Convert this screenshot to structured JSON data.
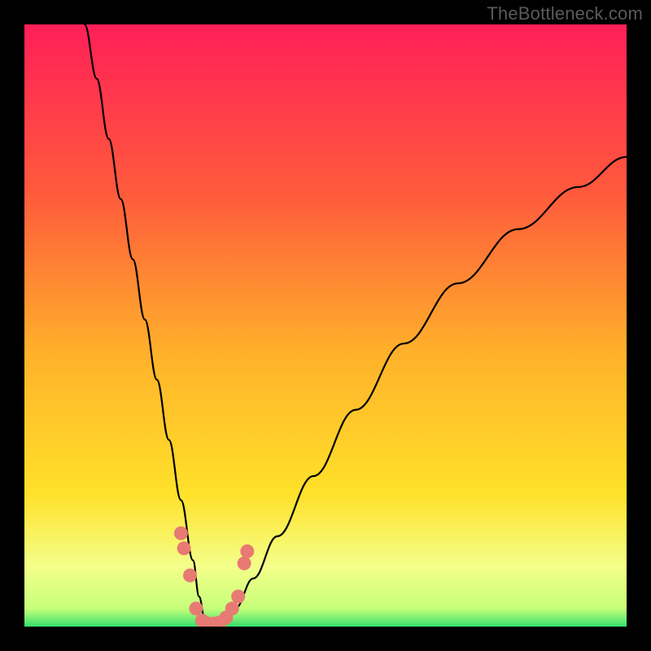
{
  "watermark": "TheBottleneck.com",
  "chart_data": {
    "type": "line",
    "title": "",
    "xlabel": "",
    "ylabel": "",
    "xlim": [
      0,
      100
    ],
    "ylim": [
      0,
      100
    ],
    "background_gradient": {
      "top": "#ff1f57",
      "mid1": "#ff7f2a",
      "mid2": "#ffe12a",
      "bottom_band": "#f4ff8a",
      "bottom_edge": "#35e06c"
    },
    "series": [
      {
        "name": "bottleneck-curve",
        "stroke": "#000000",
        "x": [
          10,
          12,
          14,
          16,
          18,
          20,
          22,
          24,
          26,
          28,
          29,
          30,
          31,
          32,
          33,
          35,
          38,
          42,
          48,
          55,
          63,
          72,
          82,
          92,
          100
        ],
        "values": [
          100,
          91,
          81,
          71,
          61,
          51,
          41,
          31,
          21,
          11,
          5,
          1,
          0.5,
          0.5,
          1,
          3,
          8,
          15,
          25,
          36,
          47,
          57,
          66,
          73,
          78
        ]
      }
    ],
    "markers": {
      "name": "highlight-dots",
      "color": "#e77a72",
      "points": [
        {
          "x": 26.0,
          "y": 15.5
        },
        {
          "x": 26.5,
          "y": 13.0
        },
        {
          "x": 27.5,
          "y": 8.5
        },
        {
          "x": 28.5,
          "y": 3.0
        },
        {
          "x": 29.5,
          "y": 1.0
        },
        {
          "x": 30.5,
          "y": 0.5
        },
        {
          "x": 31.5,
          "y": 0.5
        },
        {
          "x": 32.5,
          "y": 0.7
        },
        {
          "x": 33.5,
          "y": 1.5
        },
        {
          "x": 34.5,
          "y": 3.0
        },
        {
          "x": 35.5,
          "y": 5.0
        },
        {
          "x": 36.5,
          "y": 10.5
        },
        {
          "x": 37.0,
          "y": 12.5
        }
      ]
    }
  }
}
